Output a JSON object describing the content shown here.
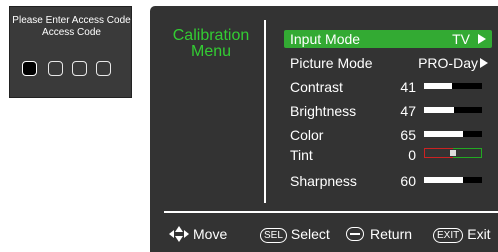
{
  "access_dialog": {
    "title": "Please Enter Access Code",
    "subtitle": "Access Code",
    "code_slots": 4,
    "active_slot": 1
  },
  "menu": {
    "title": "Calibration Menu",
    "items": [
      {
        "label": "Input Mode",
        "value": "TV",
        "selected": true
      },
      {
        "label": "Picture Mode",
        "value": "PRO-Day"
      },
      {
        "label": "Contrast",
        "value": "41",
        "level": 0.48
      },
      {
        "label": "Brightness",
        "value": "47",
        "level": 0.52
      },
      {
        "label": "Color",
        "value": "65",
        "level": 0.68
      },
      {
        "label": "Tint",
        "value": "0",
        "level": 0.5
      },
      {
        "label": "Sharpness",
        "value": "60",
        "level": 0.68
      }
    ]
  },
  "footer": {
    "move": "Move",
    "select_key": "SEL",
    "select": "Select",
    "return": "Return",
    "exit_key": "EXIT",
    "exit": "Exit"
  },
  "colors": {
    "panel": "#333333",
    "accent_green": "#33cc33",
    "selected_row": "#33aa33",
    "tint_red": "#cc2222",
    "tint_green": "#22aa22"
  }
}
